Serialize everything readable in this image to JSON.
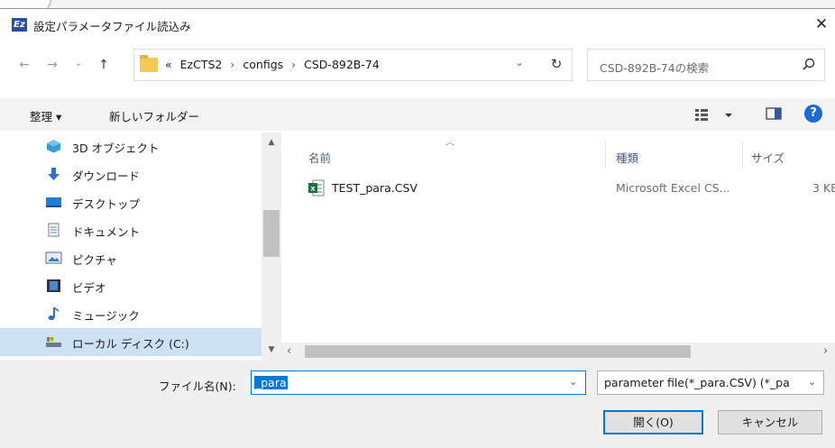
{
  "window": {
    "title": "設定パラメータファイル読込み",
    "app_icon_text": "Ez",
    "close_glyph": "✕"
  },
  "address": {
    "back_glyph": "←",
    "forward_glyph": "→",
    "recent_glyph": "⌄",
    "up_glyph": "↑",
    "overflow": "«",
    "breadcrumbs": [
      "EzCTS2",
      "configs",
      "CSD-892B-74"
    ],
    "separator": "›",
    "dropdown_glyph": "⌄",
    "refresh_glyph": "↻"
  },
  "search": {
    "placeholder": "CSD-892B-74の検索"
  },
  "toolbar": {
    "organize": "整理 ▾",
    "new_folder": "新しいフォルダー"
  },
  "nav": {
    "items": [
      {
        "label": "3D オブジェクト",
        "icon": "3d-objects-icon",
        "selected": false
      },
      {
        "label": "ダウンロード",
        "icon": "download-icon",
        "selected": false
      },
      {
        "label": "デスクトップ",
        "icon": "desktop-icon",
        "selected": false
      },
      {
        "label": "ドキュメント",
        "icon": "documents-icon",
        "selected": false
      },
      {
        "label": "ピクチャ",
        "icon": "pictures-icon",
        "selected": false
      },
      {
        "label": "ビデオ",
        "icon": "videos-icon",
        "selected": false
      },
      {
        "label": "ミュージック",
        "icon": "music-icon",
        "selected": false
      },
      {
        "label": "ローカル ディスク (C:)",
        "icon": "local-disk-icon",
        "selected": true
      }
    ]
  },
  "filelist": {
    "columns": {
      "name": "名前",
      "type": "種類",
      "size": "サイズ"
    },
    "files": [
      {
        "name": "TEST_para.CSV",
        "type": "Microsoft Excel CS...",
        "size": "3 KB"
      }
    ]
  },
  "bottom": {
    "filename_label": "ファイル名(N):",
    "filename_value": "_para",
    "filter_value": "parameter file(*_para.CSV) (*_pa",
    "open_button": "開く(O)",
    "cancel_button": "キャンセル"
  },
  "colors": {
    "accent": "#0078d7",
    "selection": "#cde1f5",
    "toolbar_bg": "#f3f3f3"
  }
}
